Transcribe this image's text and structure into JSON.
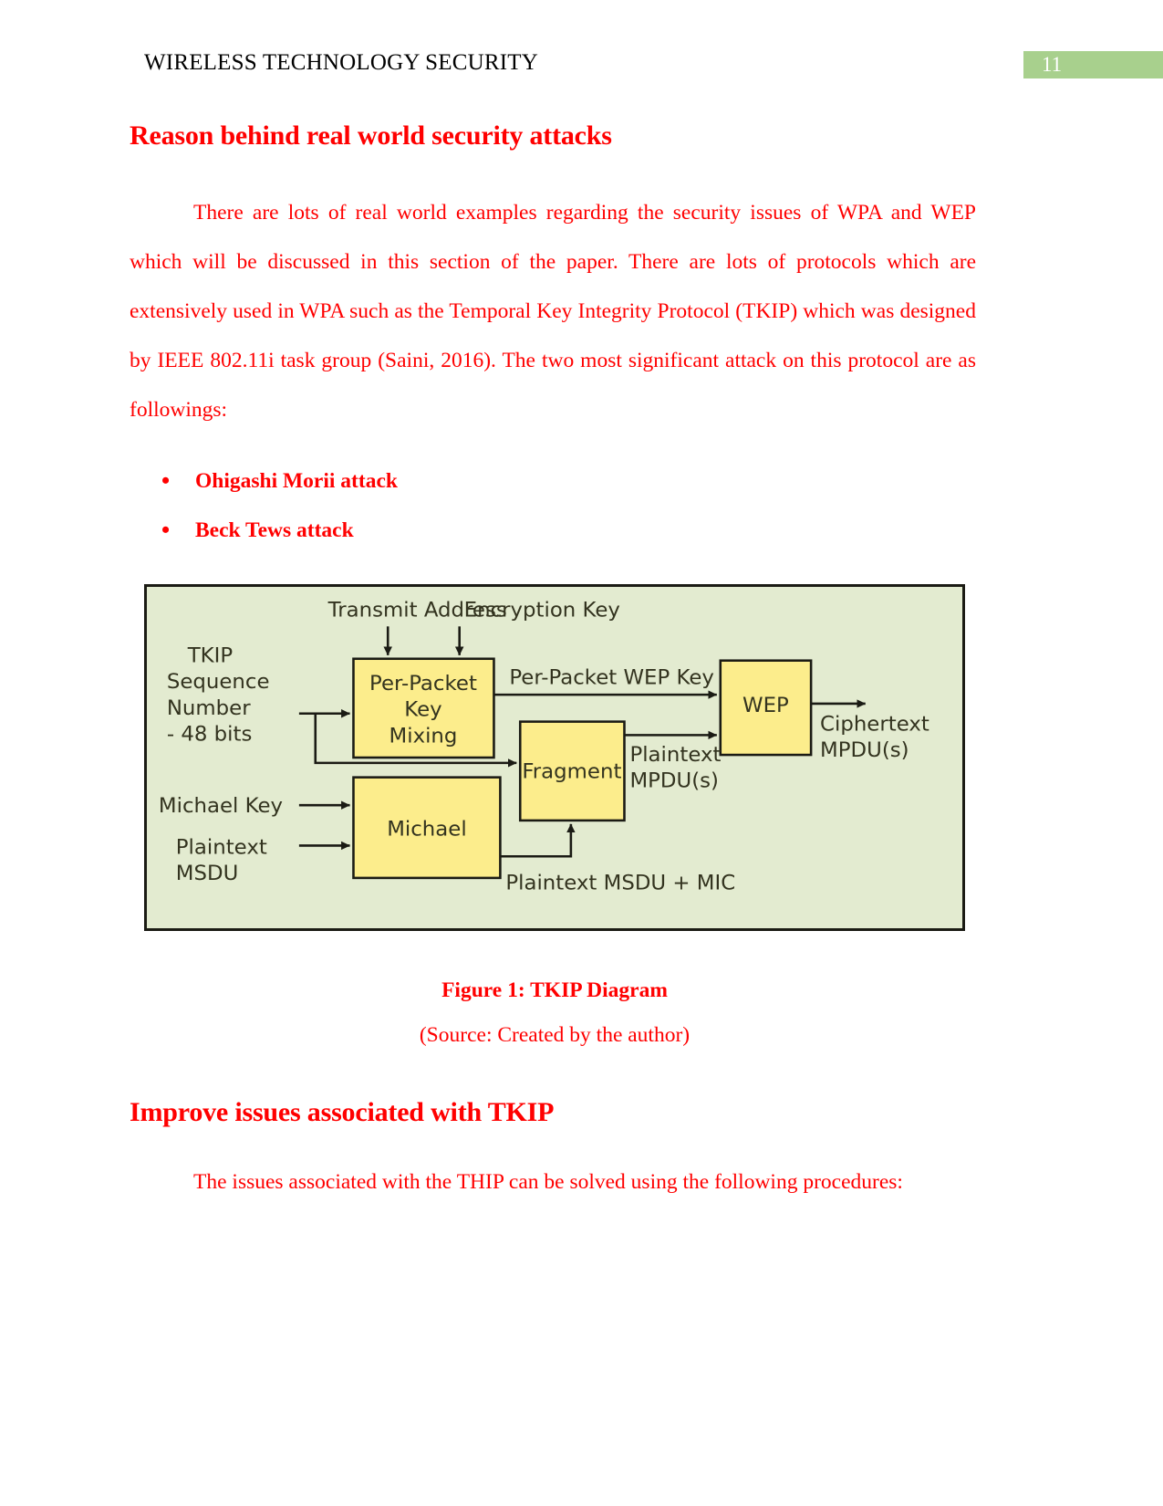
{
  "header": {
    "title": "WIRELESS TECHNOLOGY SECURITY",
    "page_number": "11",
    "badge_color": "#a8d08d"
  },
  "colors": {
    "body_text": "#ff0000",
    "header_text": "#000000",
    "figure_background": "#e3ebd0",
    "figure_box_fill": "#fced8c",
    "figure_stroke": "#1b1b14"
  },
  "sections": [
    {
      "heading": "Reason behind real world security attacks",
      "paragraph": "There are lots of real world examples regarding the security issues of WPA and WEP which will be discussed in this section of the paper. There are lots of protocols which are extensively used in WPA such as the Temporal Key Integrity Protocol (TKIP) which was designed by IEEE 802.11i task group (Saini, 2016). The two most significant attack on this protocol are as followings:",
      "bullets": [
        "Ohigashi Morii attack",
        "Beck Tews attack"
      ]
    },
    {
      "heading": "Improve issues associated with TKIP",
      "paragraph": "The issues associated with the THIP can be solved using the following procedures:"
    }
  ],
  "figure": {
    "caption": "Figure 1: TKIP Diagram",
    "source": "(Source: Created by the author)",
    "diagram": {
      "type": "block-flow",
      "title": "TKIP Diagram",
      "boxes": [
        {
          "id": "key-mixing",
          "label": "Per-Packet\nKey\nMixing",
          "line1": "Per-Packet",
          "line2": "Key",
          "line3": "Mixing"
        },
        {
          "id": "michael",
          "label": "Michael"
        },
        {
          "id": "fragment",
          "label": "Fragment"
        },
        {
          "id": "wep",
          "label": "WEP"
        }
      ],
      "inputs": [
        {
          "id": "transmit-address",
          "label": "Transmit Address"
        },
        {
          "id": "encryption-key",
          "label": "Encryption Key"
        },
        {
          "id": "tkip-sequence-number",
          "label": "TKIP\nSequence\nNumber\n- 48 bits",
          "line1": "TKIP",
          "line2": "Sequence",
          "line3": "Number",
          "line4": "- 48 bits"
        },
        {
          "id": "michael-key",
          "label": "Michael Key"
        },
        {
          "id": "plaintext-msdu",
          "label": "Plaintext\nMSDU",
          "line1": "Plaintext",
          "line2": "MSDU"
        }
      ],
      "edge_labels": [
        {
          "id": "per-packet-wep-key",
          "label": "Per-Packet WEP Key"
        },
        {
          "id": "plaintext-mpdus",
          "label": "Plaintext\nMPDU(s)",
          "line1": "Plaintext",
          "line2": "MPDU(s)"
        },
        {
          "id": "plaintext-msdu-mic",
          "label": "Plaintext MSDU + MIC"
        },
        {
          "id": "ciphertext-mpdus",
          "label": "Ciphertext\nMPDU(s)",
          "line1": "Ciphertext",
          "line2": "MPDU(s)"
        }
      ]
    }
  }
}
